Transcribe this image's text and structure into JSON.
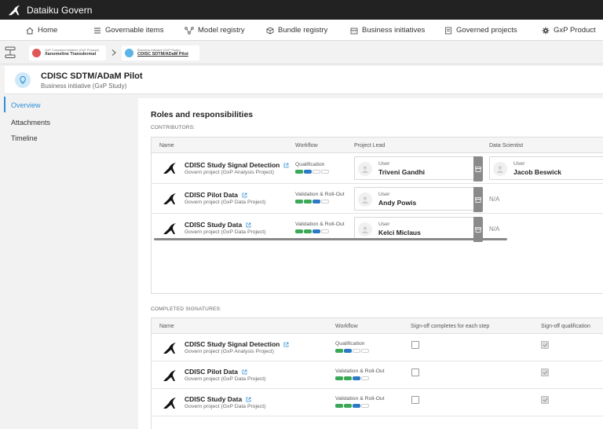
{
  "app": {
    "title": "Dataiku Govern"
  },
  "nav": [
    {
      "label": "Home",
      "icon": "home-icon"
    },
    {
      "label": "Governable items",
      "icon": "list-icon"
    },
    {
      "label": "Model registry",
      "icon": "model-icon"
    },
    {
      "label": "Bundle registry",
      "icon": "bundle-icon"
    },
    {
      "label": "Business initiatives",
      "icon": "briefcase-icon"
    },
    {
      "label": "Governed projects",
      "icon": "folder-icon"
    },
    {
      "label": "GxP Product",
      "icon": "gear-icon"
    }
  ],
  "breadcrumb": [
    {
      "sub": "GxP Compliant Initiative (GxP Product)",
      "name": "Xanomeline Transdermal"
    },
    {
      "sub": "Business initiative (GxP Study)",
      "name": "CDISC SDTM/ADaM Pilot"
    }
  ],
  "header": {
    "title": "CDISC SDTM/ADaM Pilot",
    "subtitle": "Business initiative (GxP Study)"
  },
  "sidenav": [
    {
      "label": "Overview"
    },
    {
      "label": "Attachments"
    },
    {
      "label": "Timeline"
    }
  ],
  "roles": {
    "title": "Roles and responsibilities",
    "contributors_label": "CONTRIBUTORS:",
    "columns": [
      "Name",
      "Workflow",
      "Project Lead",
      "Data Scientist"
    ],
    "rows": [
      {
        "name": "CDISC Study Signal Detection",
        "type": "Govern project (GxP Analysis Project)",
        "workflow": "Qualification",
        "steps": [
          "green",
          "blue",
          "",
          ""
        ],
        "lead_label": "User",
        "lead": "Triveni Gandhi",
        "scientist_label": "User",
        "scientist": "Jacob Beswick"
      },
      {
        "name": "CDISC Pilot Data",
        "type": "Govern project (GxP Data Project)",
        "workflow": "Validation & Roll-Out",
        "steps": [
          "green",
          "green",
          "blue",
          ""
        ],
        "lead_label": "User",
        "lead": "Andy Powis",
        "scientist": "N/A"
      },
      {
        "name": "CDISC Study Data",
        "type": "Govern project (GxP Data Project)",
        "workflow": "Validation & Roll-Out",
        "steps": [
          "green",
          "green",
          "blue",
          ""
        ],
        "lead_label": "User",
        "lead": "Kelci Miclaus",
        "scientist": "N/A"
      }
    ]
  },
  "signatures": {
    "label": "COMPLETED SIGNATURES:",
    "columns": [
      "Name",
      "Workflow",
      "Sign-off completes for each step",
      "Sign-off qualification"
    ],
    "rows": [
      {
        "name": "CDISC Study Signal Detection",
        "type": "Govern project (GxP Analysis Project)",
        "workflow": "Qualification",
        "steps": [
          "green",
          "blue",
          "",
          ""
        ],
        "step_signed": false,
        "qualification_signed": true
      },
      {
        "name": "CDISC Pilot Data",
        "type": "Govern project (GxP Data Project)",
        "workflow": "Validation & Roll-Out",
        "steps": [
          "green",
          "green",
          "blue",
          ""
        ],
        "step_signed": false,
        "qualification_signed": true
      },
      {
        "name": "CDISC Study Data",
        "type": "Govern project (GxP Data Project)",
        "workflow": "Validation & Roll-Out",
        "steps": [
          "green",
          "green",
          "blue",
          ""
        ],
        "step_signed": false,
        "qualification_signed": true
      }
    ]
  },
  "colors": {
    "accent": "#2d90d9",
    "topbar": "#222222",
    "step_done": "#3aa857",
    "step_current": "#2c7ac5"
  }
}
